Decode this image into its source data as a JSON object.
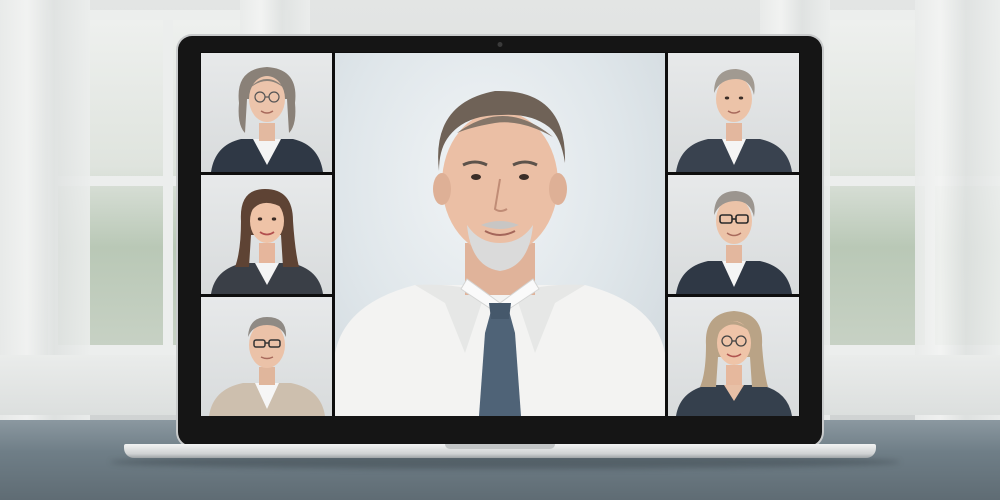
{
  "app": {
    "window_title": "",
    "camera_icon": "webcam-icon"
  },
  "participants": [
    {
      "slot": "left-1",
      "glasses": true,
      "hair": "long-gray",
      "jacket": "navy",
      "shirt": "white"
    },
    {
      "slot": "left-2",
      "glasses": false,
      "hair": "long-brown",
      "jacket": "charcoal",
      "shirt": "white"
    },
    {
      "slot": "left-3",
      "glasses": true,
      "hair": "short-gray",
      "jacket": "beige",
      "shirt": "white"
    },
    {
      "slot": "main",
      "glasses": false,
      "hair": "gray-brown",
      "beard": true,
      "shirt": "white",
      "tie": "slate-blue"
    },
    {
      "slot": "right-1",
      "glasses": false,
      "hair": "short-gray",
      "jacket": "navy",
      "shirt": "white"
    },
    {
      "slot": "right-2",
      "glasses": true,
      "hair": "short-gray",
      "jacket": "navy",
      "shirt": "white"
    },
    {
      "slot": "right-3",
      "glasses": true,
      "hair": "blonde",
      "jacket": "navy",
      "shirt": "none"
    }
  ],
  "colors": {
    "screen_bezel": "#151515",
    "tile_background": "#e1e3e4",
    "desk": "#6f7e87",
    "navy_jacket": "#3b4452",
    "tie": "#516576"
  }
}
